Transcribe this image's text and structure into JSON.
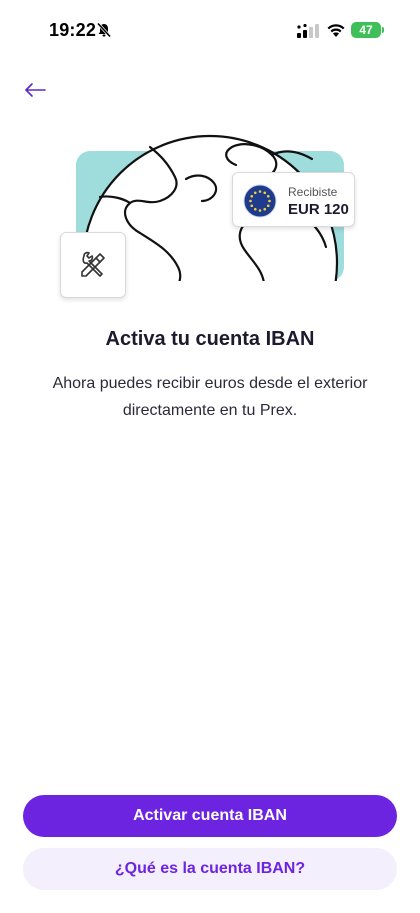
{
  "status_bar": {
    "time": "19:22",
    "battery": "47",
    "icons": [
      "bell-slash-icon",
      "signal-icon",
      "wifi-icon",
      "battery-icon"
    ]
  },
  "nav": {
    "back_icon": "arrow-left-icon"
  },
  "illustration": {
    "card_label": "Recibiste",
    "card_amount": "EUR 120",
    "icons": [
      "globe-icon",
      "tools-icon",
      "eu-flag-icon"
    ]
  },
  "content": {
    "title": "Activa tu cuenta IBAN",
    "description": "Ahora puedes recibir euros desde el exterior directamente en tu Prex."
  },
  "actions": {
    "primary_label": "Activar cuenta IBAN",
    "secondary_label": "¿Qué es la cuenta IBAN?"
  },
  "colors": {
    "accent": "#6d24e0",
    "accent_light": "#f3effc",
    "teal": "#9fdcdc",
    "battery": "#3fbf5a"
  }
}
